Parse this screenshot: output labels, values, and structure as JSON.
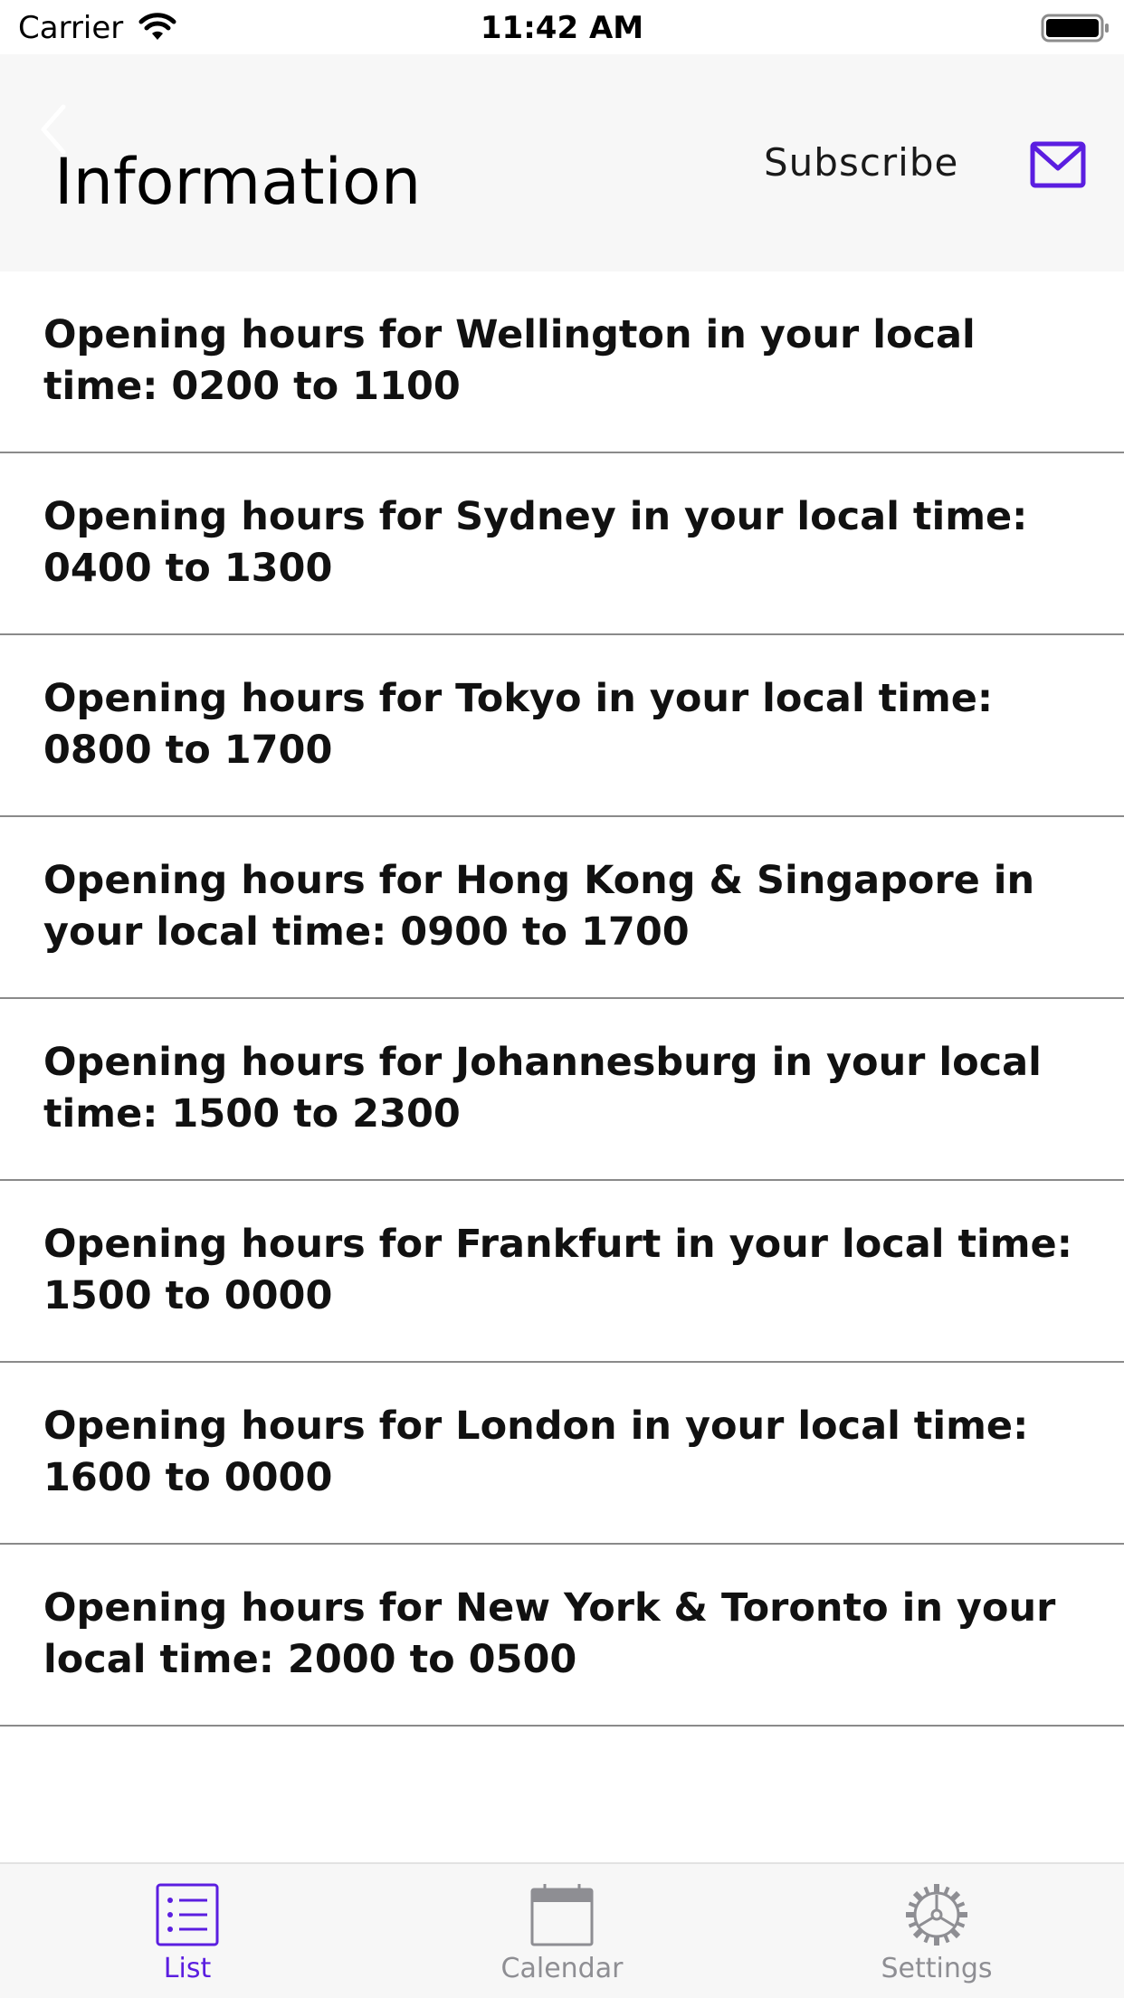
{
  "status_bar": {
    "carrier": "Carrier",
    "time": "11:42 AM"
  },
  "header": {
    "title": "Information",
    "subscribe_label": "Subscribe",
    "mail_icon": "mail-icon",
    "back_icon": "chevron-left-icon"
  },
  "items": [
    {
      "text": "Opening hours for Wellington in your local time: 0200 to 1100"
    },
    {
      "text": "Opening hours for Sydney in your local time: 0400 to 1300"
    },
    {
      "text": "Opening hours for Tokyo in your local time: 0800 to 1700"
    },
    {
      "text": "Opening hours for Hong Kong & Singapore in your local time: 0900 to 1700"
    },
    {
      "text": "Opening hours for Johannesburg in your local time: 1500 to 2300"
    },
    {
      "text": "Opening hours for Frankfurt in your local time: 1500 to 0000"
    },
    {
      "text": "Opening hours for London in your local time: 1600 to 0000"
    },
    {
      "text": "Opening hours for New York & Toronto in your local time: 2000 to 0500"
    }
  ],
  "tabs": [
    {
      "label": "List",
      "icon": "list-icon",
      "active": true
    },
    {
      "label": "Calendar",
      "icon": "calendar-icon",
      "active": false
    },
    {
      "label": "Settings",
      "icon": "settings-icon",
      "active": false
    }
  ],
  "colors": {
    "accent": "#5b1ee0",
    "header_bg": "#f7f7f7",
    "inactive_tab": "#8e8e93",
    "divider": "#8a8a8a"
  }
}
